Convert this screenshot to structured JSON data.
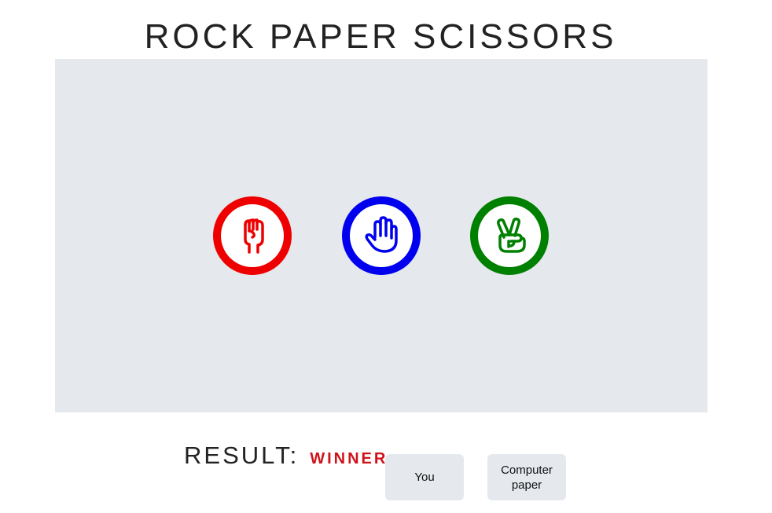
{
  "title": "ROCK PAPER SCISSORS",
  "choices": [
    {
      "name": "rock",
      "color": "#ee0000",
      "icon": "fist-icon"
    },
    {
      "name": "paper",
      "color": "#0000ee",
      "icon": "open-hand-icon"
    },
    {
      "name": "scissors",
      "color": "#008000",
      "icon": "peace-hand-icon"
    }
  ],
  "result": {
    "label": "RESULT:",
    "value": "WINNER",
    "value_color": "#d0121b"
  },
  "you": {
    "label": "You",
    "pick": ""
  },
  "computer": {
    "label": "Computer",
    "pick": "paper"
  }
}
